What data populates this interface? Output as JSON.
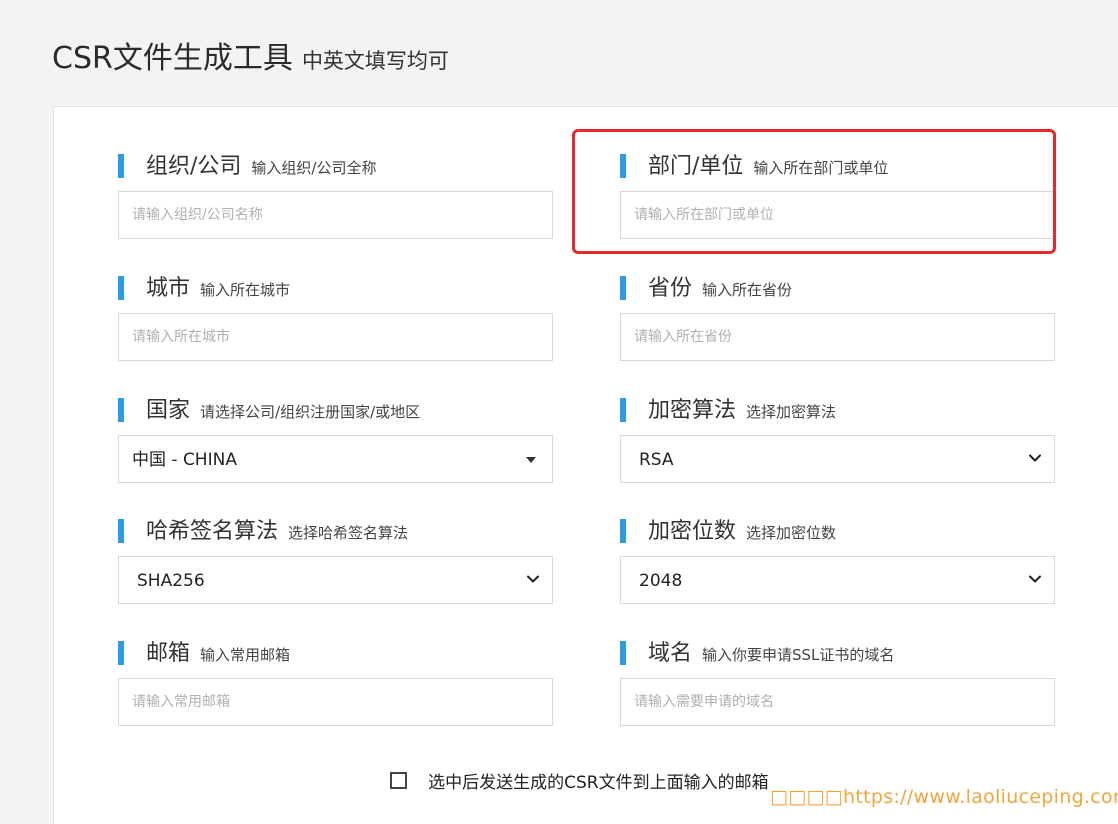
{
  "header": {
    "title": "CSR文件生成工具",
    "subtitle": "中英文填写均可"
  },
  "form": {
    "organization": {
      "label": "组织/公司",
      "hint": "输入组织/公司全称",
      "placeholder": "请输入组织/公司名称"
    },
    "department": {
      "label": "部门/单位",
      "hint": "输入所在部门或单位",
      "placeholder": "请输入所在部门或单位"
    },
    "city": {
      "label": "城市",
      "hint": "输入所在城市",
      "placeholder": "请输入所在城市"
    },
    "province": {
      "label": "省份",
      "hint": "输入所在省份",
      "placeholder": "请输入所在省份"
    },
    "country": {
      "label": "国家",
      "hint": "请选择公司/组织注册国家/或地区",
      "value": "中国 - CHINA"
    },
    "encryption_algorithm": {
      "label": "加密算法",
      "hint": "选择加密算法",
      "value": "RSA"
    },
    "hash_algorithm": {
      "label": "哈希签名算法",
      "hint": "选择哈希签名算法",
      "value": "SHA256"
    },
    "key_size": {
      "label": "加密位数",
      "hint": "选择加密位数",
      "value": "2048"
    },
    "email": {
      "label": "邮箱",
      "hint": "输入常用邮箱",
      "placeholder": "请输入常用邮箱"
    },
    "domain": {
      "label": "域名",
      "hint": "输入你要申请SSL证书的域名",
      "placeholder": "请输入需要申请的域名"
    },
    "send_email_label": "选中后发送生成的CSR文件到上面输入的邮箱"
  },
  "watermark": "□□□□https://www.laoliuceping.com",
  "colors": {
    "label_bar": "#2c9ae6",
    "highlight": "#e8282b",
    "watermark": "#f0a63a"
  }
}
